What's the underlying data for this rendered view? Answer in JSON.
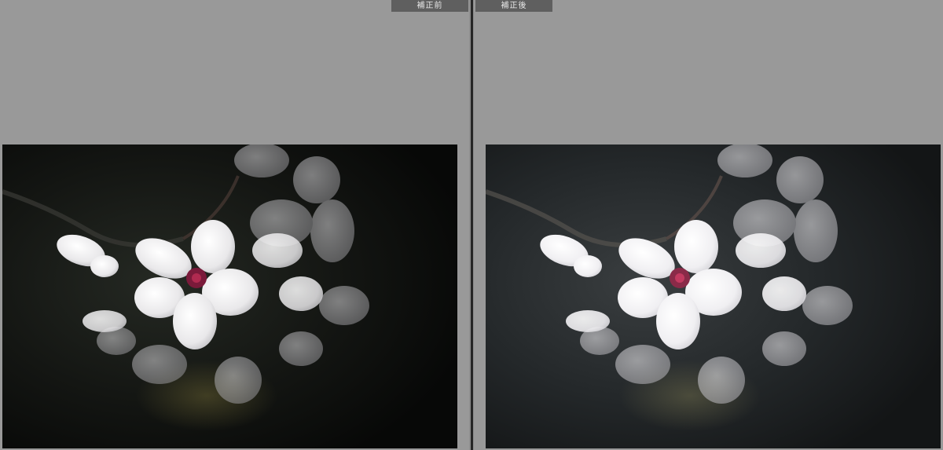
{
  "panes": [
    {
      "label": "補正前",
      "variant": "before"
    },
    {
      "label": "補正後",
      "variant": "after"
    }
  ],
  "colors": {
    "background": "#9a9a9a",
    "tab": "#5f5f5f",
    "divider": "#262626"
  }
}
